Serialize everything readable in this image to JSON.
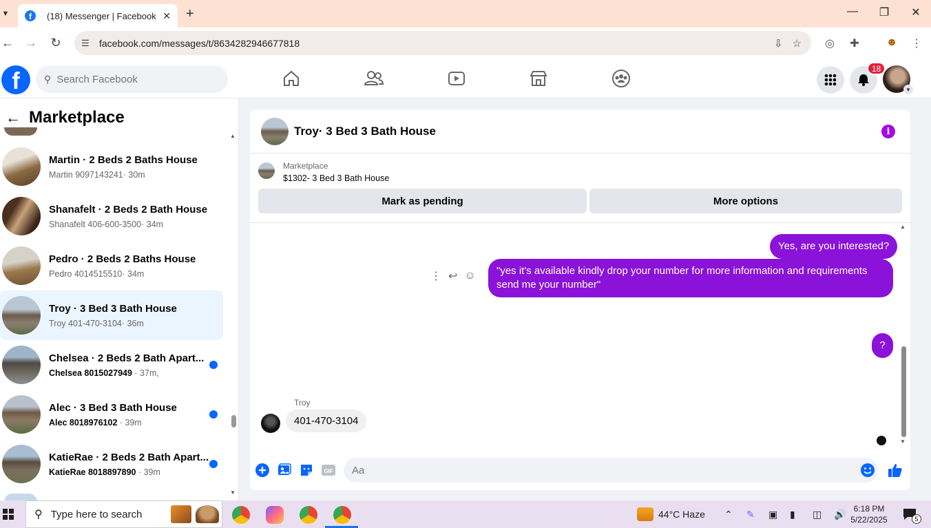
{
  "browser": {
    "tab_title": "(18) Messenger | Facebook",
    "url": "facebook.com/messages/t/8634282946677818"
  },
  "fb": {
    "search_placeholder": "Search Facebook",
    "notification_count": "18"
  },
  "sidebar": {
    "title": "Marketplace",
    "conversations": [
      {
        "name": "Martin · 2 Beds 2 Baths House",
        "sub": "Martin 9097143241",
        "time": "· 30m",
        "unread": false,
        "active": false
      },
      {
        "name": "Shanafelt · 2 Beds 2 Bath House",
        "sub": "Shanafelt 406-600-3500",
        "time": "· 34m",
        "unread": false,
        "active": false
      },
      {
        "name": "Pedro · 2 Beds 2 Baths House",
        "sub": "Pedro 4014515510",
        "time": "· 34m",
        "unread": false,
        "active": false
      },
      {
        "name": "Troy · 3 Bed 3 Bath House",
        "sub": "Troy 401-470-3104",
        "time": "· 36m",
        "unread": false,
        "active": true
      },
      {
        "name": "Chelsea · 2 Beds 2 Bath Apart...",
        "sub": "Chelsea 8015027949",
        "time": " · 37m,",
        "unread": true,
        "active": false
      },
      {
        "name": "Alec · 3 Bed 3 Bath House",
        "sub": "Alec 8018976102",
        "time": " · 39m",
        "unread": true,
        "active": false
      },
      {
        "name": "KatieRae · 2 Beds 2 Bath Apart...",
        "sub": "KatieRae 8018897890",
        "time": " · 39m",
        "unread": true,
        "active": false
      }
    ]
  },
  "chat": {
    "title": "Troy· 3 Bed 3 Bath House",
    "listing_source": "Marketplace",
    "listing_price": "$1302- 3 Bed 3 Bath House",
    "btn_pending": "Mark as pending",
    "btn_more": "More options",
    "messages": {
      "out1": "Yes, are you interested?",
      "out2": "\"yes it's available kindly drop your number for more information and requirements send me your number\"",
      "out3": "?",
      "in_name": "Troy",
      "in1": "401-470-3104"
    },
    "composer_placeholder": "Aa"
  },
  "taskbar": {
    "search_label": "Type here to search",
    "weather": "44°C  Haze",
    "time": "6:18 PM",
    "date": "5/22/2025",
    "notif_count": "5"
  },
  "colors": {
    "fb_blue": "#0866ff",
    "messenger_purple": "#8a12d9",
    "unread_dot": "#0866ff"
  }
}
